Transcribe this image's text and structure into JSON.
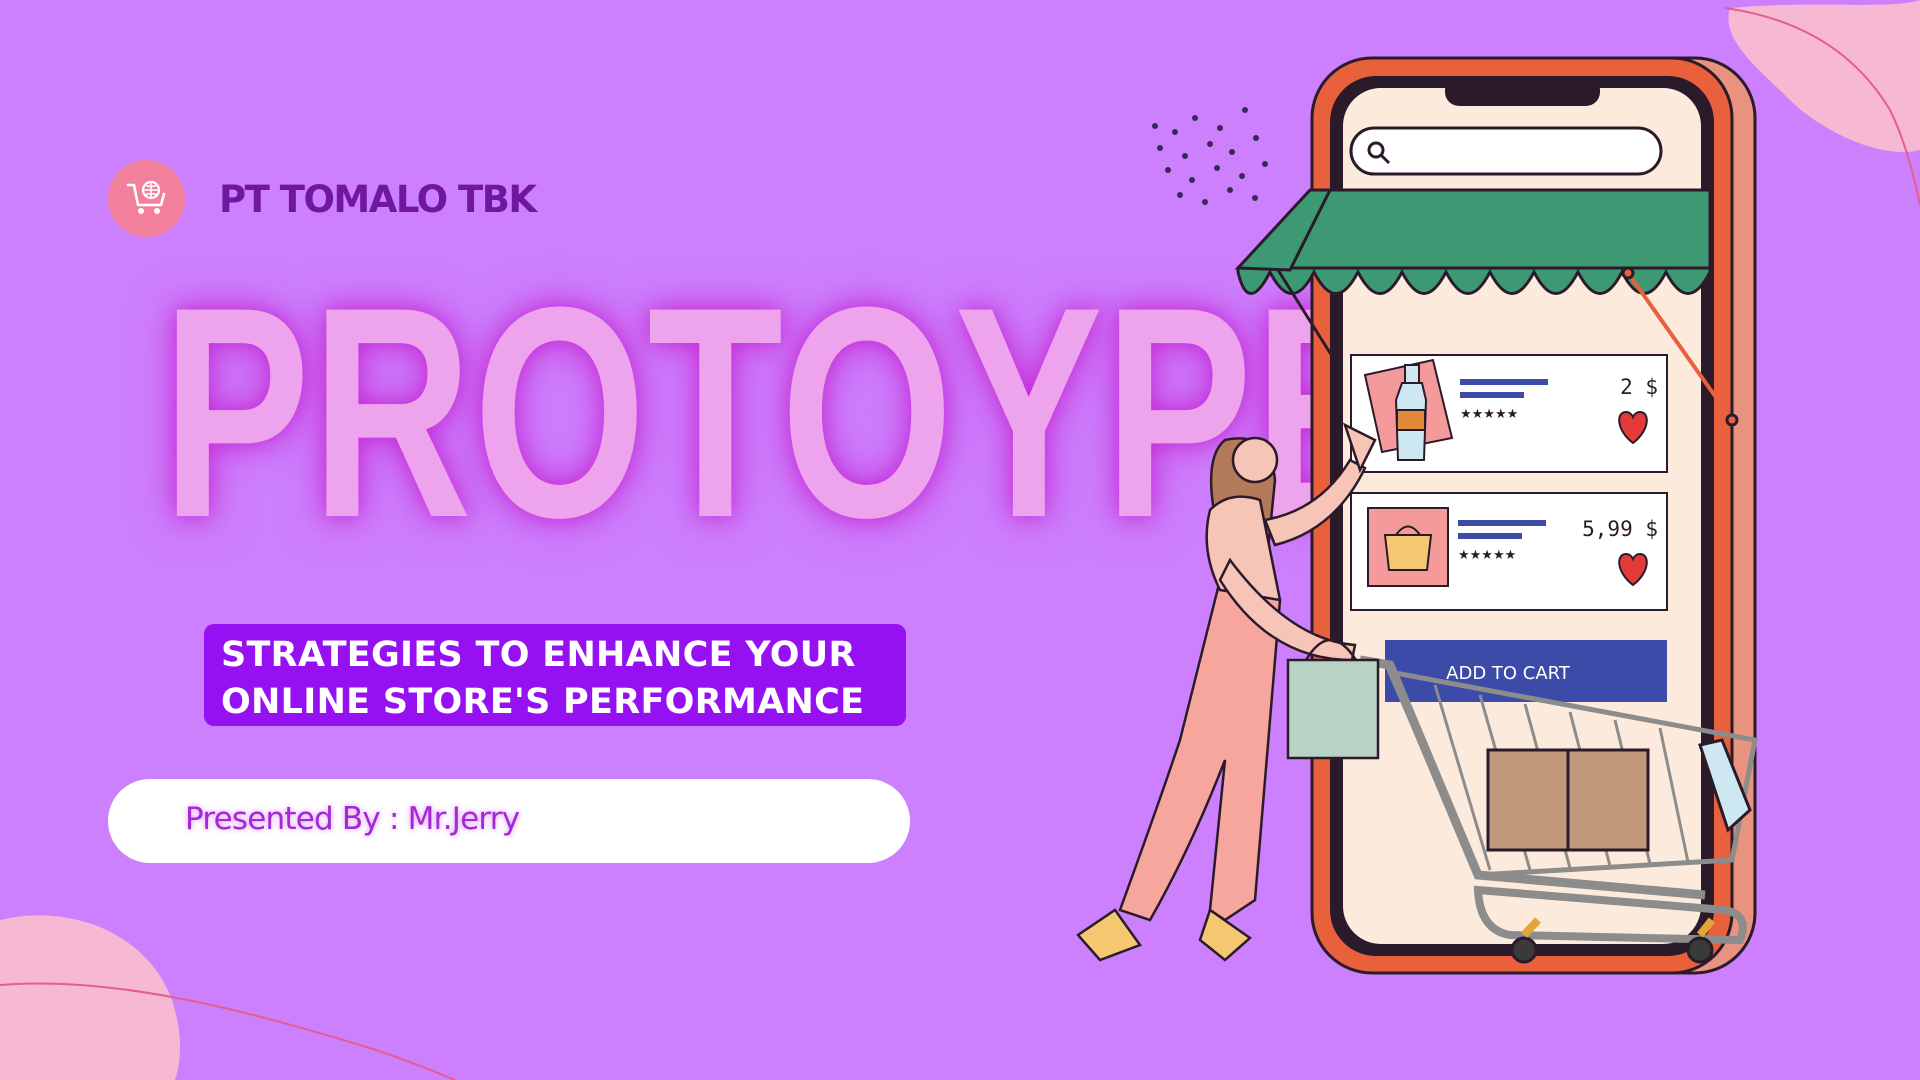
{
  "brand": {
    "company_name": "PT TOMALO TBK",
    "logo_icon": "shopping-cart-globe-icon",
    "logo_color": "#f2809c"
  },
  "title": "PROTOYPE",
  "subtitle": {
    "line1": "STRATEGIES TO ENHANCE YOUR",
    "line2": "ONLINE STORE'S PERFORMANCE"
  },
  "presenter": {
    "label": "Presented By : Mr.Jerry"
  },
  "phone_screen": {
    "search_icon": "search-icon",
    "products": [
      {
        "price": "2 $",
        "rating": "★★★★★",
        "icon": "bottle-icon"
      },
      {
        "price": "5,99 $",
        "rating": "★★★★★",
        "icon": "bag-icon"
      }
    ],
    "cart_button_label": "ADD TO CART"
  },
  "colors": {
    "background": "#cd80fd",
    "accent_purple": "#9611f1",
    "title_pink": "#eea4ec",
    "company_text": "#6f189f",
    "awning_green": "#3d9973",
    "button_blue": "#3c4aa8",
    "phone_frame": "#e8603c"
  }
}
